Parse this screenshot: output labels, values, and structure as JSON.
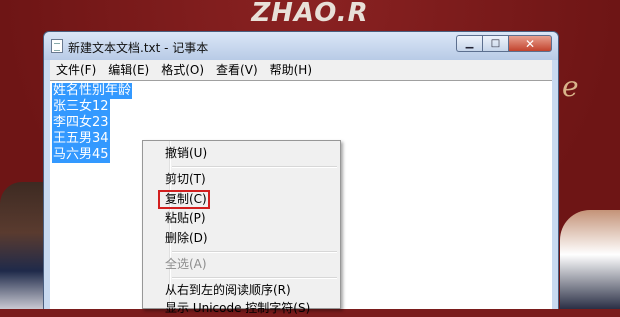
{
  "background": {
    "watermark": "ZHAO.R",
    "deco_letter": "e"
  },
  "window": {
    "title": "新建文本文档.txt - 记事本",
    "controls": {
      "minimize": "▁",
      "maximize": "□",
      "close": "✕"
    },
    "menu": [
      "文件(F)",
      "编辑(E)",
      "格式(O)",
      "查看(V)",
      "帮助(H)"
    ],
    "content_lines": [
      "姓名性别年龄",
      "张三女12",
      "李四女23",
      "王五男34",
      "马六男45"
    ],
    "selection_color": "#3399ff"
  },
  "context_menu": {
    "items": [
      {
        "label": "撤销(U)",
        "enabled": true
      },
      {
        "label": "剪切(T)",
        "enabled": true
      },
      {
        "label": "复制(C)",
        "enabled": true,
        "highlighted": true
      },
      {
        "label": "粘贴(P)",
        "enabled": true
      },
      {
        "label": "删除(D)",
        "enabled": true
      },
      {
        "label": "全选(A)",
        "enabled": false
      },
      {
        "label": "从右到左的阅读顺序(R)",
        "enabled": true
      },
      {
        "label": "显示 Unicode 控制字符(S)",
        "enabled": true
      }
    ],
    "highlight_color": "#d21f1f"
  }
}
